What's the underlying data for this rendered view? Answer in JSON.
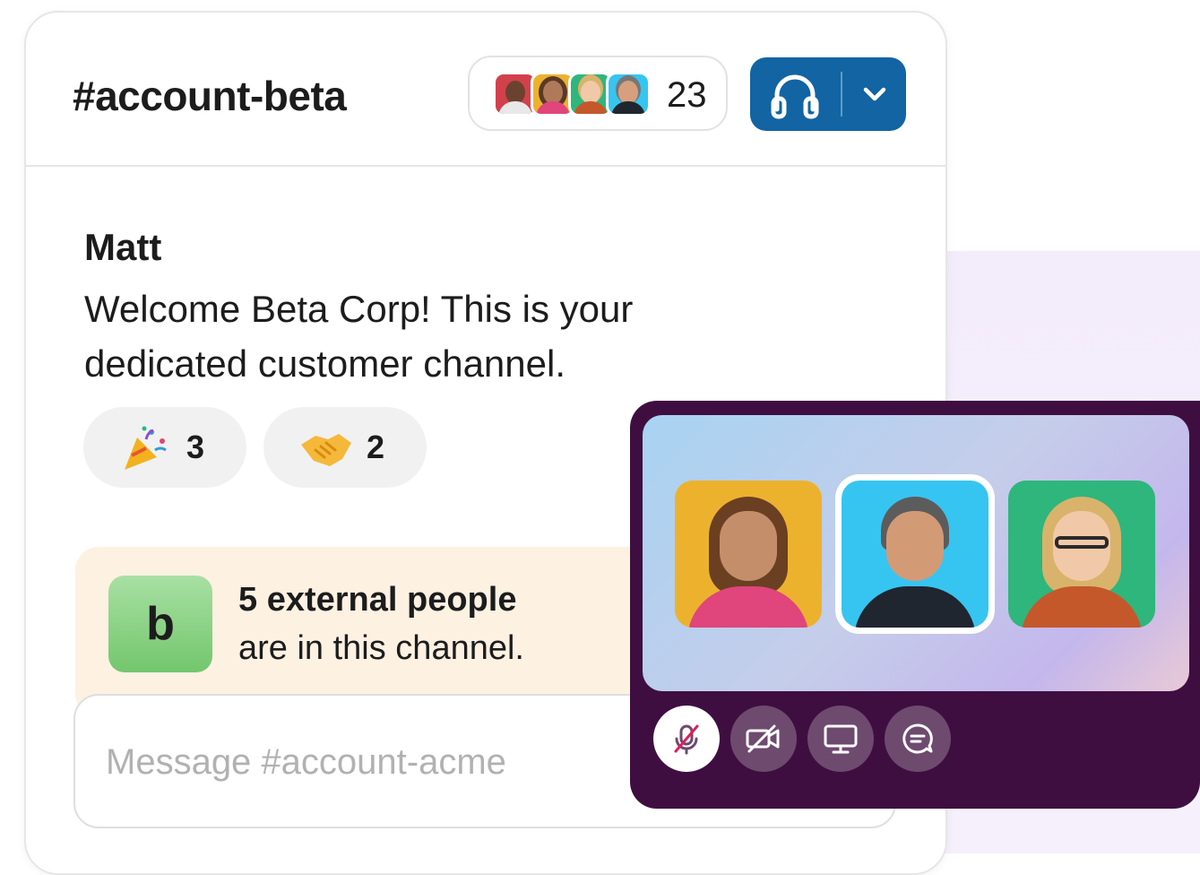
{
  "channel": {
    "name": "#account-beta",
    "member_count": "23",
    "members": [
      {
        "name": "member-1",
        "bg": "#d2414b"
      },
      {
        "name": "member-2",
        "bg": "#ecb22e"
      },
      {
        "name": "member-3",
        "bg": "#2eb67d"
      },
      {
        "name": "member-4",
        "bg": "#36c5f0"
      }
    ]
  },
  "huddle_button": {
    "icon": "headphones-icon",
    "caret_icon": "chevron-down-icon",
    "color": "#1264a3"
  },
  "message": {
    "sender": "Matt",
    "text": "Welcome Beta Corp! This is your dedicated customer channel.",
    "reactions": [
      {
        "emoji": "party-popper",
        "count": "3"
      },
      {
        "emoji": "handshake",
        "count": "2"
      }
    ]
  },
  "external_banner": {
    "logo_letter": "b",
    "title": "5 external people",
    "subtitle": "are in this channel."
  },
  "composer": {
    "placeholder": "Message #account-acme"
  },
  "huddle_window": {
    "background": "#3f0e40",
    "participants": [
      {
        "name": "participant-1",
        "bg": "#ecb22e",
        "active": false
      },
      {
        "name": "participant-2",
        "bg": "#36c5f0",
        "active": true
      },
      {
        "name": "participant-3",
        "bg": "#2eb67d",
        "active": false
      }
    ],
    "controls": [
      {
        "name": "mute-toggle",
        "icon": "microphone-off-icon",
        "on": true
      },
      {
        "name": "video-toggle",
        "icon": "video-off-icon",
        "on": false
      },
      {
        "name": "share-screen",
        "icon": "monitor-icon",
        "on": false
      },
      {
        "name": "huddle-thread",
        "icon": "chat-bubble-icon",
        "on": false
      }
    ]
  }
}
